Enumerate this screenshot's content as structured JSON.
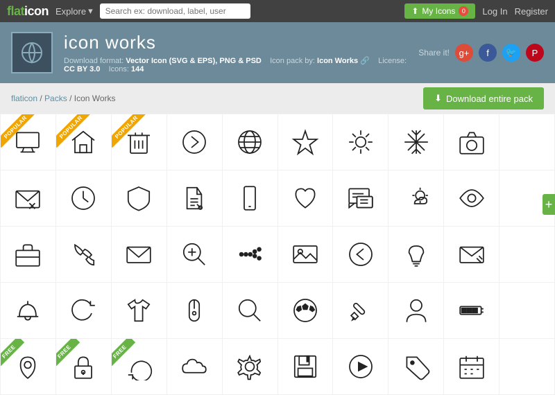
{
  "topnav": {
    "logo_flat": "flat",
    "logo_icon": "icon",
    "explore_label": "Explore",
    "search_placeholder": "Search ex: download, label, user",
    "my_icons_label": "My Icons",
    "my_icons_badge": "0",
    "login_label": "Log In",
    "register_label": "Register"
  },
  "pack_header": {
    "title": "icon works",
    "meta_format": "Download format:",
    "format_value": "Vector Icon (SVG & EPS), PNG & PSD",
    "meta_pack": "Icon pack by:",
    "pack_by": "Icon Works",
    "meta_license": "License:",
    "license_value": "CC BY 3.0",
    "meta_icons": "Icons:",
    "icons_count": "144",
    "share_label": "Share it!"
  },
  "breadcrumb": {
    "flaticon": "flaticon",
    "packs": "Packs",
    "current": "Icon Works"
  },
  "download": {
    "label": "Download entire pack"
  },
  "icons": [
    {
      "symbol": "monitor",
      "ribbon": "popular"
    },
    {
      "symbol": "home",
      "ribbon": "popular"
    },
    {
      "symbol": "trash",
      "ribbon": "popular"
    },
    {
      "symbol": "chevron-right"
    },
    {
      "symbol": "globe"
    },
    {
      "symbol": "star"
    },
    {
      "symbol": "sun"
    },
    {
      "symbol": "snowflake"
    },
    {
      "symbol": "camera"
    },
    {
      "symbol": "spacer"
    },
    {
      "symbol": "mail-x"
    },
    {
      "symbol": "clock"
    },
    {
      "symbol": "shield"
    },
    {
      "symbol": "doc-edit"
    },
    {
      "symbol": "phone"
    },
    {
      "symbol": "heart"
    },
    {
      "symbol": "chat"
    },
    {
      "symbol": "cloud-sun"
    },
    {
      "symbol": "eye"
    },
    {
      "symbol": "spacer"
    },
    {
      "symbol": "briefcase"
    },
    {
      "symbol": "telephone"
    },
    {
      "symbol": "envelope"
    },
    {
      "symbol": "search-plus"
    },
    {
      "symbol": "dots"
    },
    {
      "symbol": "image"
    },
    {
      "symbol": "chevron-left"
    },
    {
      "symbol": "bulb"
    },
    {
      "symbol": "mail-edit"
    },
    {
      "symbol": "spacer"
    },
    {
      "symbol": "bell"
    },
    {
      "symbol": "refresh"
    },
    {
      "symbol": "shirt"
    },
    {
      "symbol": "mouse"
    },
    {
      "symbol": "magnify"
    },
    {
      "symbol": "soccer"
    },
    {
      "symbol": "pencil"
    },
    {
      "symbol": "user"
    },
    {
      "symbol": "battery"
    },
    {
      "symbol": "spacer"
    },
    {
      "symbol": "location",
      "ribbon": "free"
    },
    {
      "symbol": "lock",
      "ribbon": "free"
    },
    {
      "symbol": "refresh2",
      "ribbon": "free"
    },
    {
      "symbol": "cloud"
    },
    {
      "symbol": "gear"
    },
    {
      "symbol": "floppy"
    },
    {
      "symbol": "play"
    },
    {
      "symbol": "tag"
    },
    {
      "symbol": "calendar"
    },
    {
      "symbol": "spacer"
    }
  ]
}
